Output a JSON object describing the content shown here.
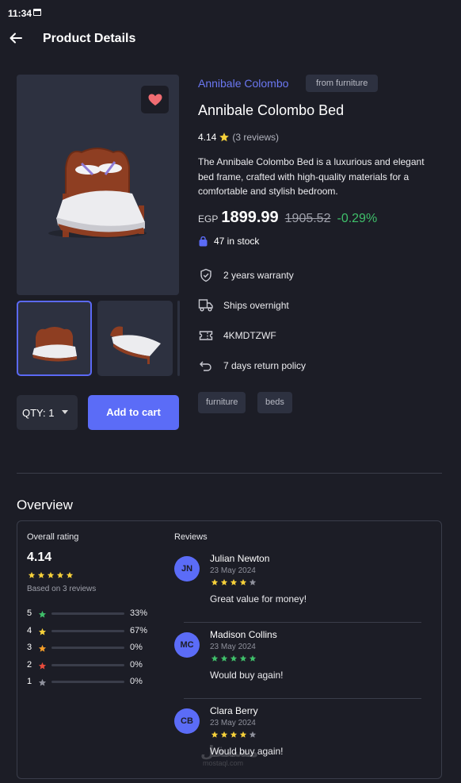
{
  "status_bar": {
    "time": "11:34"
  },
  "app_bar": {
    "title": "Product Details"
  },
  "product": {
    "brand": "Annibale Colombo",
    "category_chip": "from furniture",
    "title": "Annibale Colombo Bed",
    "rating": "4.14",
    "reviews_count": "(3 reviews)",
    "description": "The Annibale Colombo Bed is a luxurious and elegant bed frame, crafted with high-quality materials for a comfortable and stylish bedroom.",
    "currency": "EGP",
    "price": "1899.99",
    "old_price": "1905.52",
    "discount": "-0.29%",
    "stock": "47 in stock",
    "features": [
      {
        "icon": "shield-check-icon",
        "label": "2 years warranty"
      },
      {
        "icon": "truck-icon",
        "label": "Ships overnight"
      },
      {
        "icon": "ticket-icon",
        "label": "4KMDTZWF"
      },
      {
        "icon": "return-icon",
        "label": "7 days return policy"
      }
    ],
    "tags": [
      "furniture",
      "beds"
    ]
  },
  "purchase": {
    "qty_label": "QTY: 1",
    "add_to_cart": "Add to cart"
  },
  "overview": {
    "title": "Overview",
    "overall_label": "Overall rating",
    "overall_value": "4.14",
    "overall_stars": 5,
    "based_on": "Based on 3 reviews",
    "distribution": [
      {
        "star": "5",
        "percent": "33%",
        "fraction": 0.33,
        "color": "#3fbf6a"
      },
      {
        "star": "4",
        "percent": "67%",
        "fraction": 0.67,
        "color": "#f5d03a"
      },
      {
        "star": "3",
        "percent": "0%",
        "fraction": 0,
        "color": "#f59e2a"
      },
      {
        "star": "2",
        "percent": "0%",
        "fraction": 0,
        "color": "#e84b3c"
      },
      {
        "star": "1",
        "percent": "0%",
        "fraction": 0,
        "color": "#8f919c"
      }
    ],
    "reviews_label": "Reviews",
    "reviews": [
      {
        "initials": "JN",
        "name": "Julian Newton",
        "date": "23 May 2024",
        "stars": 4,
        "star_color": "#f5d03a",
        "text": "Great value for money!"
      },
      {
        "initials": "MC",
        "name": "Madison Collins",
        "date": "23 May 2024",
        "stars": 5,
        "star_color": "#3fbf6a",
        "text": "Would buy again!"
      },
      {
        "initials": "CB",
        "name": "Clara Berry",
        "date": "23 May 2024",
        "stars": 4,
        "star_color": "#f5d03a",
        "text": "Would buy again!"
      }
    ]
  },
  "watermark": {
    "text": "مستقل",
    "sub": "mostaql.com"
  },
  "colors": {
    "accent": "#5b6cf7",
    "background": "#1c1d26",
    "surface": "#2d3140",
    "success": "#3fbf6a"
  }
}
